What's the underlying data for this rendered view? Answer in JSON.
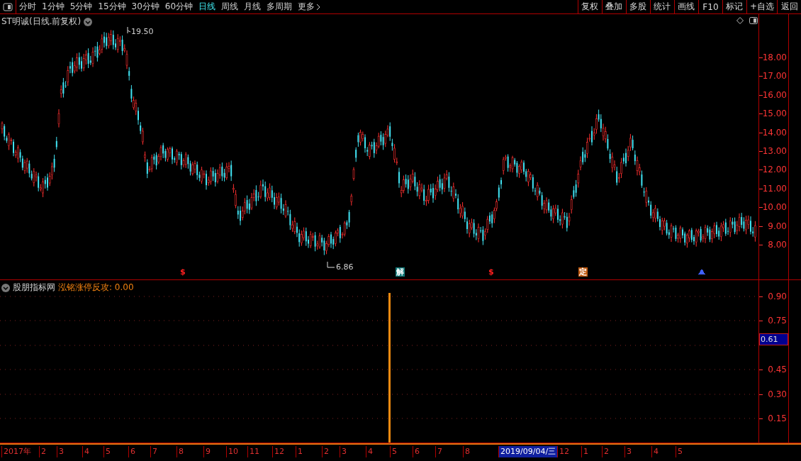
{
  "toolbar": {
    "periods": [
      {
        "label": "分时",
        "selected": false
      },
      {
        "label": "1分钟",
        "selected": false
      },
      {
        "label": "5分钟",
        "selected": false
      },
      {
        "label": "15分钟",
        "selected": false
      },
      {
        "label": "30分钟",
        "selected": false
      },
      {
        "label": "60分钟",
        "selected": false
      },
      {
        "label": "日线",
        "selected": true
      },
      {
        "label": "周线",
        "selected": false
      },
      {
        "label": "月线",
        "selected": false
      },
      {
        "label": "多周期",
        "selected": false
      },
      {
        "label": "更多",
        "selected": false
      }
    ],
    "buttons": [
      "复权",
      "叠加",
      "多股",
      "统计",
      "画线",
      "F10",
      "标记",
      "+自选",
      "返回"
    ]
  },
  "price_panel": {
    "title": "ST明诚(日线.前复权)",
    "high_label": "19.50",
    "low_label": "6.86",
    "y_axis": [
      "18.00",
      "17.00",
      "16.00",
      "15.00",
      "14.00",
      "13.00",
      "12.00",
      "11.00",
      "10.00",
      "9.00",
      "8.00"
    ],
    "signals": [
      {
        "kind": "mark",
        "text": "$",
        "color": "#ff2020"
      },
      {
        "kind": "badge",
        "text": "解",
        "color": "#107878"
      },
      {
        "kind": "mark",
        "text": "$",
        "color": "#ff2020"
      },
      {
        "kind": "badge",
        "text": "定",
        "color": "#c05a10"
      },
      {
        "kind": "arrow",
        "color": "#4060ff"
      }
    ]
  },
  "indicator_panel": {
    "source": "股朋指标网",
    "name": "泓铭涨停反攻: 0.00",
    "y_axis": [
      "0.90",
      "0.75",
      "0.45",
      "0.30",
      "0.15"
    ],
    "cursor_value": "0.61"
  },
  "date_axis": [
    {
      "text": "2017年",
      "selected": false
    },
    {
      "text": "2",
      "selected": false
    },
    {
      "text": "3",
      "selected": false
    },
    {
      "text": "4",
      "selected": false
    },
    {
      "text": "5",
      "selected": false
    },
    {
      "text": "6",
      "selected": false
    },
    {
      "text": "7",
      "selected": false
    },
    {
      "text": "8",
      "selected": false
    },
    {
      "text": "9",
      "selected": false
    },
    {
      "text": "10",
      "selected": false
    },
    {
      "text": "11",
      "selected": false
    },
    {
      "text": "12",
      "selected": false
    },
    {
      "text": "1",
      "selected": false
    },
    {
      "text": "2",
      "selected": false
    },
    {
      "text": "3",
      "selected": false
    },
    {
      "text": "4",
      "selected": false
    },
    {
      "text": "5",
      "selected": false
    },
    {
      "text": "6",
      "selected": false
    },
    {
      "text": "7",
      "selected": false
    },
    {
      "text": "8",
      "selected": false
    },
    {
      "text": "2019/09/04/三",
      "selected": true
    },
    {
      "text": "12",
      "selected": false
    },
    {
      "text": "1",
      "selected": false
    },
    {
      "text": "2",
      "selected": false
    },
    {
      "text": "3",
      "selected": false
    },
    {
      "text": "4",
      "selected": false
    },
    {
      "text": "5",
      "selected": false
    }
  ]
}
